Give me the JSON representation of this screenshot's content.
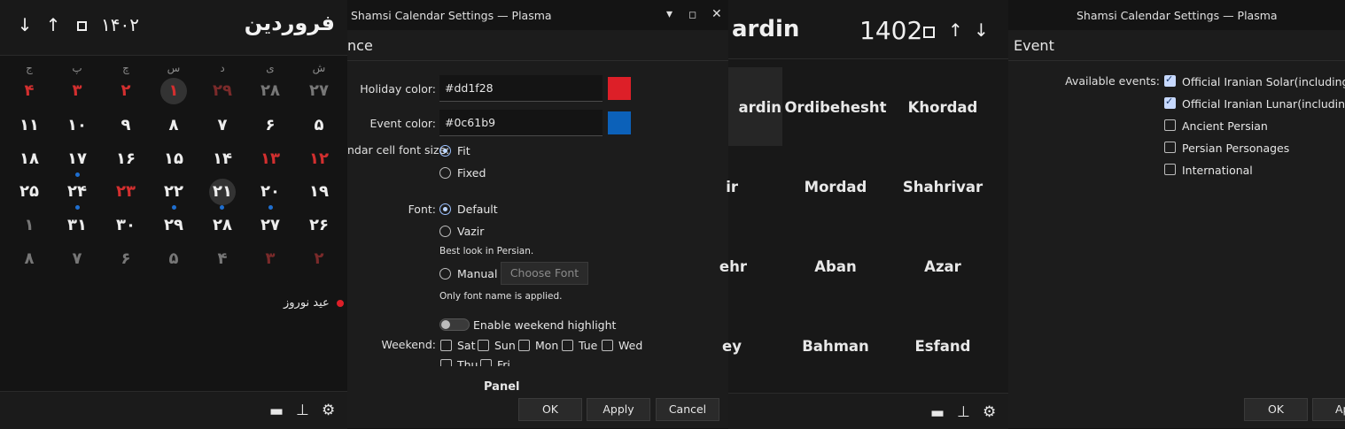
{
  "persian_calendar": {
    "month_title": "فروردین",
    "year": "۱۴۰۲",
    "weekday_headers": [
      "ش",
      "ی",
      "د",
      "س",
      "چ",
      "پ",
      "ج"
    ],
    "weeks": [
      [
        "۲۷",
        "۲۸",
        "۲۹",
        "۱",
        "۲",
        "۳",
        "۴"
      ],
      [
        "۵",
        "۶",
        "۷",
        "۸",
        "۹",
        "۱۰",
        "۱۱"
      ],
      [
        "۱۲",
        "۱۳",
        "۱۴",
        "۱۵",
        "۱۶",
        "۱۷",
        "۱۸"
      ],
      [
        "۱۹",
        "۲۰",
        "۲۱",
        "۲۲",
        "۲۳",
        "۲۴",
        "۲۵"
      ],
      [
        "۲۶",
        "۲۷",
        "۲۸",
        "۲۹",
        "۳۰",
        "۳۱",
        "۱"
      ],
      [
        "۲",
        "۳",
        "۴",
        "۵",
        "۶",
        "۷",
        "۸"
      ]
    ],
    "event_text": "عید نوروز"
  },
  "settings_dialog_1": {
    "window_title": "Shamsi Calendar Settings — Plasma",
    "section_title": "nce",
    "holiday_color_label": "Holiday color:",
    "holiday_color_value": "#dd1f28",
    "event_color_label": "Event color:",
    "event_color_value": "#0c61b9",
    "cell_font_size_label": "ndar cell font size:",
    "size_options": [
      "Fit",
      "Fixed"
    ],
    "font_label": "Font:",
    "font_options": [
      "Default",
      "Vazir",
      "Manual"
    ],
    "vazir_note": "Best look in Persian.",
    "choose_font_button": "Choose Font",
    "manual_note": "Only font name is applied.",
    "weekend_highlight_label": "Enable weekend highlight",
    "weekend_label": "Weekend:",
    "weekend_days_row1": [
      "Sat",
      "Sun",
      "Mon",
      "Tue",
      "Wed"
    ],
    "weekend_days_row2": [
      "Thu",
      "Fri"
    ],
    "panel_heading": "Panel",
    "ok_button": "OK",
    "apply_button": "Apply",
    "cancel_button": "Cancel"
  },
  "month_view": {
    "partial_month_title": "ardin",
    "year": "1402",
    "months": [
      [
        "ardin",
        "Ordibehesht",
        "Khordad"
      ],
      [
        "ir",
        "Mordad",
        "Shahrivar"
      ],
      [
        "ehr",
        "Aban",
        "Azar"
      ],
      [
        "ey",
        "Bahman",
        "Esfand"
      ]
    ]
  },
  "settings_dialog_2": {
    "window_title": "Shamsi Calendar Settings — Plasma",
    "section_title": "Event",
    "available_events_label": "Available events:",
    "events": [
      {
        "label": "Official Iranian Solar(including ho",
        "checked": true
      },
      {
        "label": "Official Iranian Lunar(including h",
        "checked": true
      },
      {
        "label": "Ancient Persian",
        "checked": false
      },
      {
        "label": "Persian Personages",
        "checked": false
      },
      {
        "label": "International",
        "checked": false
      }
    ],
    "ok_button": "OK",
    "apply_button_partial": "Ap"
  },
  "colors": {
    "holiday": "#dd1f28",
    "event": "#0c61b9"
  }
}
